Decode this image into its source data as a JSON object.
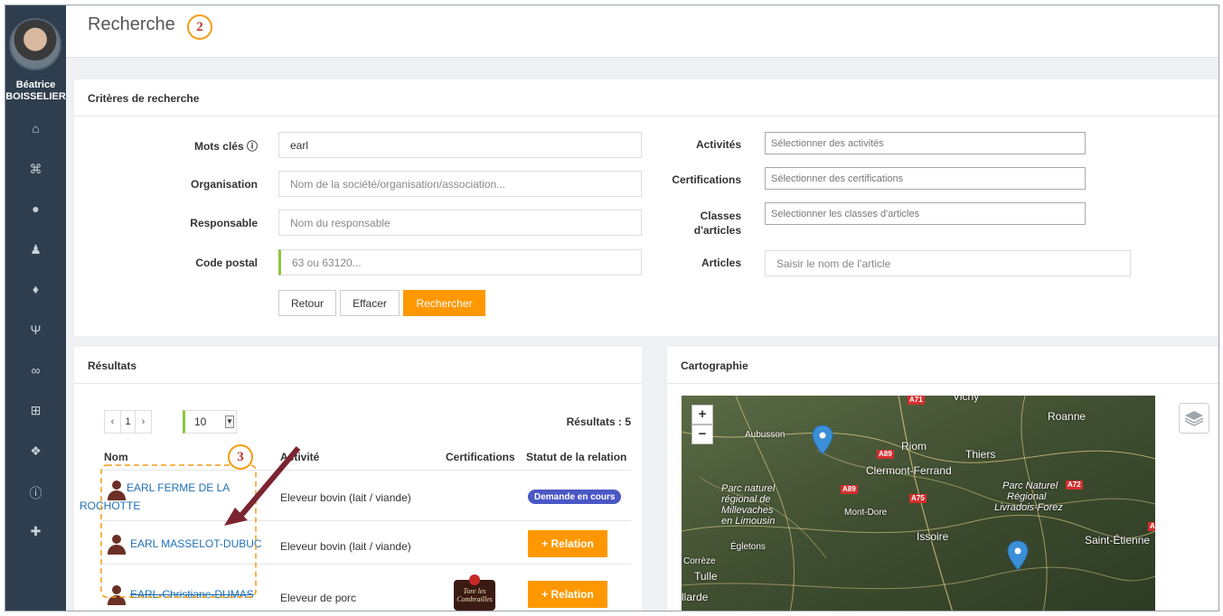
{
  "user": {
    "first_name": "Béatrice",
    "last_name": "BOISSELIER"
  },
  "sidebar": {
    "icons": [
      "home-icon",
      "bank-icon",
      "comments-icon",
      "users-icon",
      "bell-icon",
      "cutlery-icon",
      "handshake-icon",
      "cart-icon",
      "cubes-icon",
      "info-icon",
      "user-plus-icon"
    ],
    "glyphs": [
      "⌂",
      "⌘",
      "●",
      "♟",
      "♦",
      "Ψ",
      "∞",
      "⊞",
      "❖",
      "ⓘ",
      "✚"
    ]
  },
  "page": {
    "title": "Recherche"
  },
  "callouts": {
    "two": "2",
    "three": "3"
  },
  "criteria": {
    "title": "Critères de recherche",
    "keywords": {
      "label": "Mots clés",
      "info_icon": "ⓘ",
      "value": "earl"
    },
    "organisation": {
      "label": "Organisation",
      "placeholder": "Nom de la société/organisation/association..."
    },
    "responsable": {
      "label": "Responsable",
      "placeholder": "Nom du responsable"
    },
    "postal": {
      "label": "Code postal",
      "placeholder": "63 ou 63120..."
    },
    "activities": {
      "label": "Activités",
      "placeholder": "Sélectionner des activités"
    },
    "certifications": {
      "label": "Certifications",
      "placeholder": "Sélectionner des certifications"
    },
    "classes": {
      "label_line1": "Classes",
      "label_line2": "d'articles",
      "placeholder": "Selectionner les classes d'articles"
    },
    "articles": {
      "label": "Articles",
      "placeholder": "Saisir le nom de l'article"
    },
    "buttons": {
      "back": "Retour",
      "clear": "Effacer",
      "search": "Rechercher"
    }
  },
  "results": {
    "title": "Résultats",
    "pager": {
      "prev": "‹",
      "current": "1",
      "next": "›"
    },
    "per_page": "10",
    "count_label": "Résultats : 5",
    "columns": {
      "name": "Nom",
      "activity": "Activité",
      "certifications": "Certifications",
      "status": "Statut de la relation"
    },
    "rows": [
      {
        "name_line1": "EARL FERME DE LA",
        "name_line2": "ROCHOTTE",
        "activity": "Eleveur bovin (lait / viande)",
        "status": "Demande en cours"
      },
      {
        "name_line1": "EARL MASSELOT-DUBUC",
        "activity": "Eleveur bovin (lait / viande)",
        "status": "+ Relation"
      },
      {
        "name_line1": "EARL-Christiane-DUMAS",
        "activity": "Eleveur de porc",
        "cert_text": "Tore les Combrailles",
        "status": "+ Relation"
      }
    ]
  },
  "map": {
    "title": "Cartographie",
    "zoom_in": "+",
    "zoom_out": "−",
    "cities": [
      "Vichy",
      "Roanne",
      "Aubusson",
      "Riom",
      "Thiers",
      "Clermont-Ferrand",
      "Mont-Dore",
      "Issoire",
      "Saint-Étienne",
      "Égletons",
      "Corrèze",
      "Tulle",
      "llarde"
    ],
    "regions": [
      "Parc naturel",
      "régional de",
      "Millevaches",
      "en Limousin",
      "Parc Naturel",
      "Régional",
      "Livradois-Forez"
    ],
    "roads": [
      "A71",
      "A89",
      "A89",
      "A72",
      "A75",
      "A"
    ],
    "pin_color": "#3b8fd6"
  },
  "colors": {
    "accent": "#ff9800",
    "sidebar": "#2f3e4e",
    "link": "#1f6fb5",
    "badge": "#4a57c5",
    "field_accent": "#8dc63f",
    "callout": "#f39c12"
  }
}
